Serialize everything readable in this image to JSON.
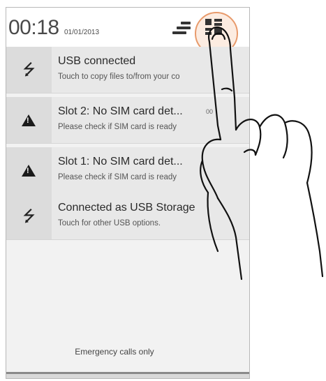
{
  "statusbar": {
    "time": "00:18",
    "date": "01/01/2013",
    "icons": {
      "quick_settings": "quick-settings-icon",
      "settings": "settings-toggle-icon"
    }
  },
  "notifications": [
    {
      "icon": "usb-icon",
      "title": "USB connected",
      "subtitle": "Touch to copy files to/from your co",
      "time": ""
    },
    {
      "icon": "warning-icon",
      "title": "Slot 2: No SIM card det...",
      "subtitle": "Please check if SIM card is ready",
      "time": "00"
    },
    {
      "icon": "warning-icon",
      "title": "Slot 1: No SIM card det...",
      "subtitle": "Please check if SIM card is ready",
      "time": ""
    },
    {
      "icon": "usb-icon",
      "title": "Connected as USB Storage",
      "subtitle": "Touch for other USB options.",
      "time": ""
    }
  ],
  "footer": {
    "emergency": "Emergency calls only"
  },
  "colors": {
    "tap_ring": "#e89a6b",
    "panel_bg": "#f2f2f2",
    "notification_bg": "#e8e8e8"
  }
}
